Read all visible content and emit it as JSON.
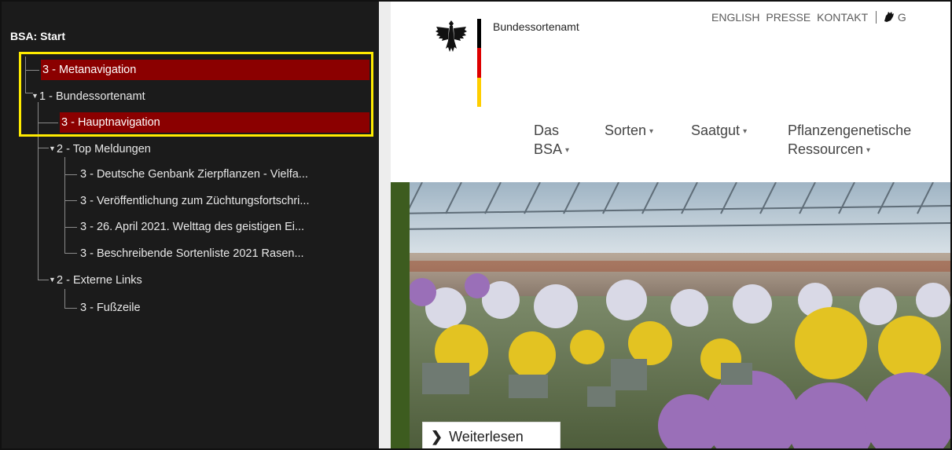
{
  "tree_panel": {
    "title": "BSA: Start",
    "nodes": [
      {
        "label": "3 - Metanavigation"
      },
      {
        "label": "1 -  Bundessortenamt"
      },
      {
        "label": "3 - Hauptnavigation"
      },
      {
        "label": "2 - Top Meldungen"
      },
      {
        "label": "3 -  Deutsche Genbank Zierpflanzen - Vielfa..."
      },
      {
        "label": "3 -  Veröffentlichung zum Züchtungsfortschri..."
      },
      {
        "label": "3 -  26. April 2021. Welttag des geistigen Ei..."
      },
      {
        "label": "3 -  Beschreibende Sortenliste 2021 Rasen..."
      },
      {
        "label": "2 - Externe Links"
      },
      {
        "label": "3 - Fußzeile"
      }
    ],
    "expand_glyph": "▼",
    "highlight_color": "#8b0000",
    "box_color": "#ffeb00"
  },
  "website": {
    "brand": "Bundessortenamt",
    "meta_nav": [
      "ENGLISH",
      "PRESSE",
      "KONTAKT"
    ],
    "meta_nav_extra": "G",
    "main_nav": [
      {
        "line1": "Das",
        "line2": "BSA"
      },
      {
        "line1": "Sorten"
      },
      {
        "line1": "Saatgut"
      },
      {
        "line1": "Pflanzengenetische",
        "line2": "Ressourcen"
      }
    ],
    "caret": "▾",
    "read_more": "Weiterlesen",
    "read_more_icon": "chevron-right-icon",
    "flag_colors": [
      "#000000",
      "#dd0000",
      "#ffce00"
    ]
  }
}
